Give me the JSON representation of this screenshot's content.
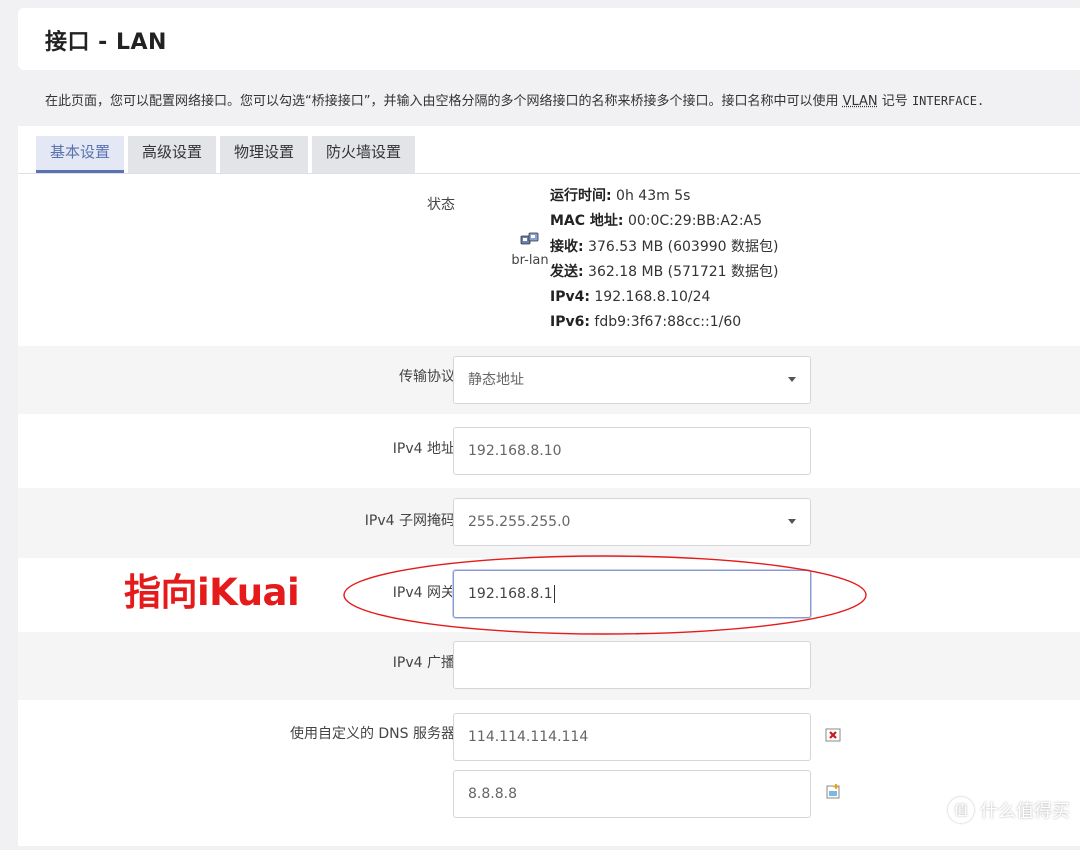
{
  "header": {
    "title": "接口 - LAN"
  },
  "description": {
    "text_before": "在此页面，您可以配置网络接口。您可以勾选“桥接接口”，并输入由空格分隔的多个网络接口的名称来桥接多个接口。接口名称中可以使用 ",
    "vlan_link": "VLAN",
    "text_middle": " 记号 ",
    "mono": "INTERFACE."
  },
  "tabs": [
    {
      "label": "基本设置",
      "active": true
    },
    {
      "label": "高级设置",
      "active": false
    },
    {
      "label": "物理设置",
      "active": false
    },
    {
      "label": "防火墙设置",
      "active": false
    }
  ],
  "status": {
    "label": "状态",
    "interface_name": "br-lan",
    "interface_icon": "network-interface-icon",
    "lines": [
      {
        "key": "运行时间:",
        "value": " 0h 43m 5s"
      },
      {
        "key": "MAC 地址:",
        "value": " 00:0C:29:BB:A2:A5"
      },
      {
        "key": "接收:",
        "value": " 376.53 MB (603990 数据包)"
      },
      {
        "key": "发送:",
        "value": " 362.18 MB (571721 数据包)"
      },
      {
        "key": "IPv4:",
        "value": " 192.168.8.10/24"
      },
      {
        "key": "IPv6:",
        "value": " fdb9:3f67:88cc::1/60"
      }
    ]
  },
  "fields": {
    "protocol": {
      "label": "传输协议",
      "value": "静态地址"
    },
    "ipv4_address": {
      "label": "IPv4 地址",
      "value": "192.168.8.10"
    },
    "ipv4_netmask": {
      "label": "IPv4 子网掩码",
      "value": "255.255.255.0"
    },
    "ipv4_gateway": {
      "label": "IPv4 网关",
      "value": "192.168.8.1"
    },
    "ipv4_broadcast": {
      "label": "IPv4 广播",
      "value": ""
    },
    "dns": {
      "label": "使用自定义的 DNS 服务器",
      "values": [
        "114.114.114.114",
        "8.8.8.8"
      ]
    }
  },
  "annotation": {
    "text": "指向iKuai",
    "color": "#e51a1a"
  },
  "watermark": {
    "icon_text": "值",
    "text": "什么值得买"
  },
  "colors": {
    "accent": "#5a72b0",
    "annotation": "#e51a1a"
  }
}
